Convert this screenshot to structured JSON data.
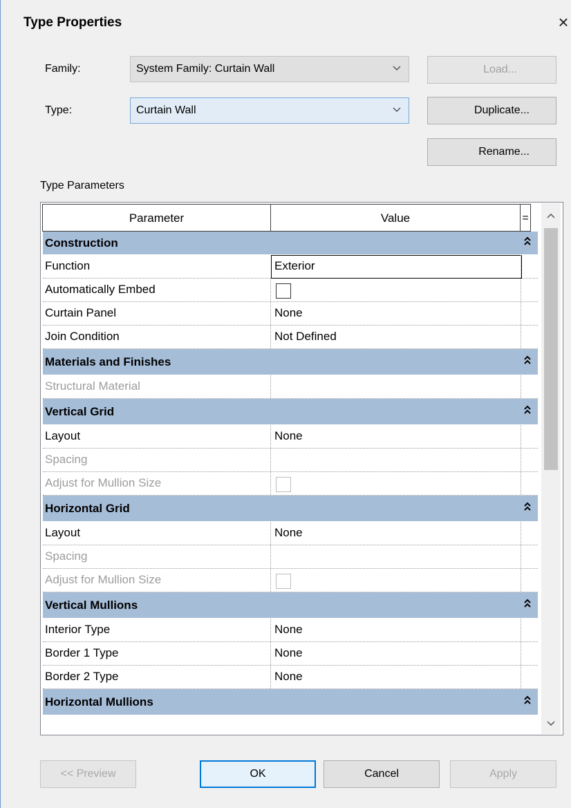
{
  "dialog": {
    "title": "Type Properties",
    "close_glyph": "×"
  },
  "family": {
    "label": "Family:",
    "value": "System Family: Curtain Wall"
  },
  "type": {
    "label": "Type:",
    "value": "Curtain Wall"
  },
  "side_buttons": {
    "load": "Load...",
    "duplicate": "Duplicate...",
    "rename": "Rename..."
  },
  "type_parameters": {
    "label": "Type Parameters",
    "header": {
      "parameter": "Parameter",
      "value": "Value",
      "extra": "="
    },
    "groups": [
      {
        "name": "Construction",
        "rows": [
          {
            "param": "Function",
            "value": "Exterior"
          },
          {
            "param": "Automatically Embed",
            "value": ""
          },
          {
            "param": "Curtain Panel",
            "value": "None"
          },
          {
            "param": "Join Condition",
            "value": "Not Defined"
          }
        ]
      },
      {
        "name": "Materials and Finishes",
        "rows": [
          {
            "param": "Structural Material",
            "value": ""
          }
        ]
      },
      {
        "name": "Vertical Grid",
        "rows": [
          {
            "param": "Layout",
            "value": "None"
          },
          {
            "param": "Spacing",
            "value": ""
          },
          {
            "param": "Adjust for Mullion Size",
            "value": ""
          }
        ]
      },
      {
        "name": "Horizontal Grid",
        "rows": [
          {
            "param": "Layout",
            "value": "None"
          },
          {
            "param": "Spacing",
            "value": ""
          },
          {
            "param": "Adjust for Mullion Size",
            "value": ""
          }
        ]
      },
      {
        "name": "Vertical Mullions",
        "rows": [
          {
            "param": "Interior Type",
            "value": "None"
          },
          {
            "param": "Border 1 Type",
            "value": "None"
          },
          {
            "param": "Border 2 Type",
            "value": "None"
          }
        ]
      },
      {
        "name": "Horizontal Mullions",
        "rows": []
      }
    ],
    "collapse_glyph": "≈"
  },
  "footer": {
    "preview": "<< Preview",
    "ok": "OK",
    "cancel": "Cancel",
    "apply": "Apply"
  },
  "colors": {
    "group_header_bg": "#a6bdd8",
    "dialog_bg": "#f0f0f0",
    "focus_border": "#0078d7"
  },
  "icons": {
    "close": "close-icon",
    "dropdown": "chevron-down-icon",
    "collapse": "collapse-chevrons-icon",
    "scroll_up": "scroll-up-icon",
    "scroll_down": "scroll-down-icon"
  }
}
